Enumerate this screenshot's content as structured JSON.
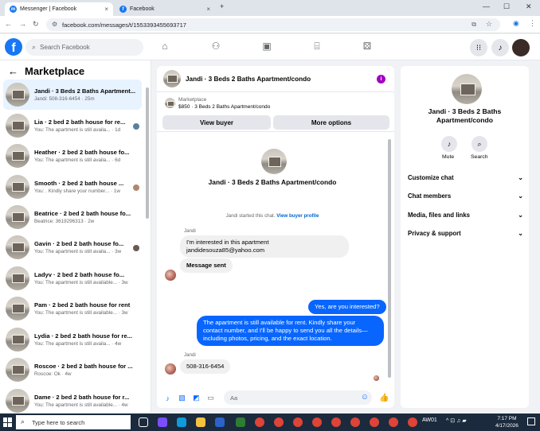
{
  "browser": {
    "tabs": [
      {
        "label": "Messenger | Facebook",
        "close": "×"
      },
      {
        "label": "Facebook",
        "close": "×"
      }
    ],
    "new_tab": "+",
    "url": "facebook.com/messages/t/1553393455693717",
    "window_controls": {
      "minimize": "—",
      "maximize": "☐",
      "close": "✕"
    }
  },
  "fb": {
    "logo": "f",
    "search_placeholder": "Search Facebook"
  },
  "left": {
    "title": "Marketplace",
    "back": "←",
    "conversations": [
      {
        "name": "Jandi · 3 Beds 2 Baths Apartment...",
        "preview": "Jandi: 508-316-6454 · 25m",
        "selected": true
      },
      {
        "name": "Lia · 2 bed 2 bath house for re...",
        "preview": "You: The apartment is still availa... · 1d"
      },
      {
        "name": "Heather · 2 bed 2 bath house fo...",
        "preview": "You: The apartment is still availa... · 6d"
      },
      {
        "name": "Smooth · 2 bed 2 bath house ...",
        "preview": "You: . Kindly share your number... · 1w"
      },
      {
        "name": "Beatrice · 2 bed 2 bath house fo...",
        "preview": "Beatrice: 3619296313 · 2w"
      },
      {
        "name": "Gavin · 2 bed 2 bath house fo...",
        "preview": "You: The apartment is still availa... · 3w"
      },
      {
        "name": "Ladyv · 2 bed 2 bath house fo...",
        "preview": "You: The apartment is still available... · 3w"
      },
      {
        "name": "Pam · 2 bed 2 bath house for rent",
        "preview": "You: The apartment is still available... · 3w"
      },
      {
        "name": "Lydia · 2 bed 2 bath house for re...",
        "preview": "You: The apartment is still availa... · 4w"
      },
      {
        "name": "Roscoe · 2 bed 2 bath house for ...",
        "preview": "Roscoe: Ok · 4w"
      },
      {
        "name": "Dame · 2 bed 2 bath house for r...",
        "preview": "You: The apartment is still available... · 4w"
      }
    ]
  },
  "chat": {
    "title": "Jandi · 3 Beds 2 Baths Apartment/condo",
    "info": "i",
    "marketplace_label": "Marketplace",
    "listing": "$850 · 3 Beds 2 Baths Apartment/condo",
    "view_buyer": "View buyer",
    "more_options": "More options",
    "center_name": "Jandi · 3 Beds 2 Baths Apartment/condo",
    "system_text": "Jandi started this chat.",
    "system_link": "View buyer profile",
    "messages": [
      {
        "sender": "Jandi",
        "line1": "I'm interested in this apartment",
        "line2": "jandidesouza85@yahoo.com"
      },
      {
        "text": "Message sent"
      },
      {
        "text": "Yes, are you interested?"
      },
      {
        "line1": "The apartment is still available for rent. Kindly share your",
        "line2": "contact number, and I'll be happy to send you all the details—",
        "line3": "including photos, pricing, and the exact location."
      },
      {
        "sender": "Jandi",
        "text": "508-316-6454"
      }
    ],
    "composer_placeholder": "Aa"
  },
  "right": {
    "title_line1": "Jandi · 3 Beds 2 Baths",
    "title_line2": "Apartment/condo",
    "mute": "Mute",
    "search": "Search",
    "menu": [
      "Customize chat",
      "Chat members",
      "Media, files and links",
      "Privacy & support"
    ]
  },
  "taskbar": {
    "search_placeholder": "Type here to search",
    "tray": "AW01",
    "time": "7:17 PM",
    "date": "4/17/2026"
  }
}
